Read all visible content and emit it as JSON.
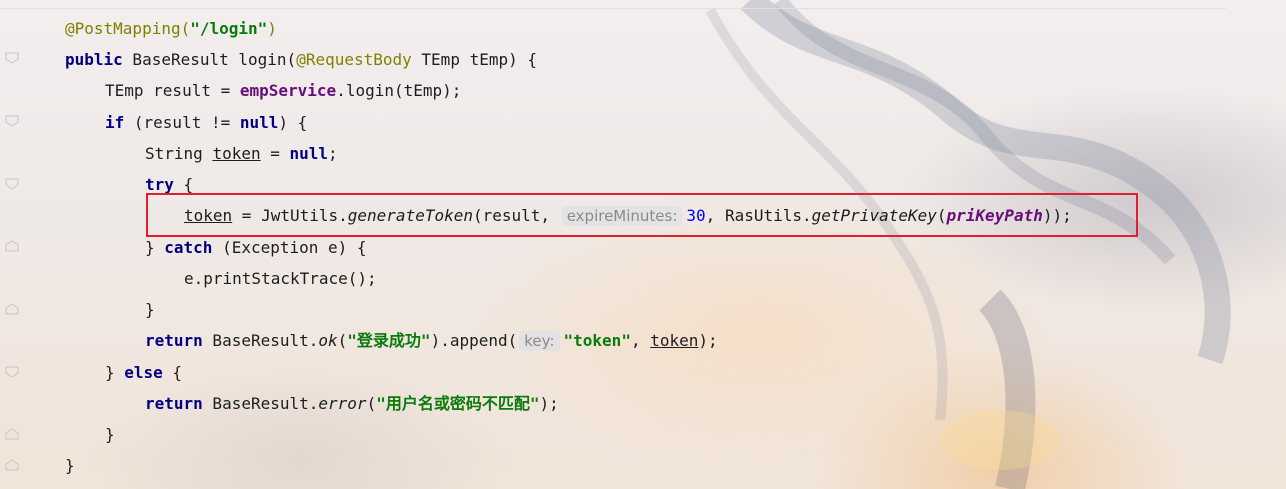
{
  "editor": {
    "lines": [
      {
        "id": "l1",
        "parts": [
          {
            "t": "@PostMapping(",
            "c": "anno"
          },
          {
            "t": "\"/login\"",
            "c": "str"
          },
          {
            "t": ")",
            "c": "anno"
          }
        ]
      },
      {
        "id": "l2",
        "parts": [
          {
            "t": "public",
            "c": "kw"
          },
          {
            "t": " BaseResult login(",
            "c": ""
          },
          {
            "t": "@RequestBody",
            "c": "anno"
          },
          {
            "t": " TEmp tEmp) {",
            "c": ""
          }
        ]
      },
      {
        "id": "l3",
        "parts": [
          {
            "t": "TEmp result = ",
            "c": ""
          },
          {
            "t": "empService",
            "c": "field"
          },
          {
            "t": ".login(tEmp);",
            "c": ""
          }
        ]
      },
      {
        "id": "l4",
        "parts": [
          {
            "t": "if",
            "c": "kw"
          },
          {
            "t": " (result != ",
            "c": ""
          },
          {
            "t": "null",
            "c": "kw"
          },
          {
            "t": ") {",
            "c": ""
          }
        ]
      },
      {
        "id": "l5",
        "parts": [
          {
            "t": "String ",
            "c": ""
          },
          {
            "t": "token",
            "c": "ul"
          },
          {
            "t": " = ",
            "c": ""
          },
          {
            "t": "null",
            "c": "kw"
          },
          {
            "t": ";",
            "c": ""
          }
        ]
      },
      {
        "id": "l6",
        "parts": [
          {
            "t": "try",
            "c": "kw"
          },
          {
            "t": " {",
            "c": ""
          }
        ]
      },
      {
        "id": "l7",
        "parts": [
          {
            "t": "token",
            "c": "ul"
          },
          {
            "t": " = JwtUtils.",
            "c": ""
          },
          {
            "t": "generateToken",
            "c": "ital"
          },
          {
            "t": "(result, ",
            "c": ""
          },
          {
            "t": "expireMinutes:",
            "c": "hint"
          },
          {
            "t": "30",
            "c": "num"
          },
          {
            "t": ", RasUtils.",
            "c": ""
          },
          {
            "t": "getPrivateKey",
            "c": "ital"
          },
          {
            "t": "(",
            "c": ""
          },
          {
            "t": "priKeyPath",
            "c": "static-field"
          },
          {
            "t": "));",
            "c": ""
          }
        ]
      },
      {
        "id": "l8",
        "parts": [
          {
            "t": "} ",
            "c": ""
          },
          {
            "t": "catch",
            "c": "kw"
          },
          {
            "t": " (Exception e) {",
            "c": ""
          }
        ]
      },
      {
        "id": "l9",
        "parts": [
          {
            "t": "e.printStackTrace();",
            "c": ""
          }
        ]
      },
      {
        "id": "l10",
        "parts": [
          {
            "t": "}",
            "c": ""
          }
        ]
      },
      {
        "id": "l11",
        "parts": [
          {
            "t": "return",
            "c": "kw"
          },
          {
            "t": " BaseResult.",
            "c": ""
          },
          {
            "t": "ok",
            "c": "ital"
          },
          {
            "t": "(",
            "c": ""
          },
          {
            "t": "\"登录成功\"",
            "c": "str"
          },
          {
            "t": ").append(",
            "c": ""
          },
          {
            "t": "key:",
            "c": "hint"
          },
          {
            "t": "\"token\"",
            "c": "str"
          },
          {
            "t": ", ",
            "c": ""
          },
          {
            "t": "token",
            "c": "ul"
          },
          {
            "t": ");",
            "c": ""
          }
        ]
      },
      {
        "id": "l12",
        "parts": [
          {
            "t": "} ",
            "c": ""
          },
          {
            "t": "else",
            "c": "kw"
          },
          {
            "t": " {",
            "c": ""
          }
        ]
      },
      {
        "id": "l13",
        "parts": [
          {
            "t": "return",
            "c": "kw"
          },
          {
            "t": " BaseResult.",
            "c": ""
          },
          {
            "t": "error",
            "c": "ital"
          },
          {
            "t": "(",
            "c": ""
          },
          {
            "t": "\"用户名或密码不匹配\"",
            "c": "str"
          },
          {
            "t": ");",
            "c": ""
          }
        ]
      },
      {
        "id": "l14",
        "parts": [
          {
            "t": "}",
            "c": ""
          }
        ]
      },
      {
        "id": "l15",
        "parts": [
          {
            "t": "}",
            "c": ""
          }
        ]
      }
    ]
  },
  "colors": {
    "keyword": "#000080",
    "annotation": "#808000",
    "string": "#0a7a0a",
    "field": "#660e7a",
    "number": "#0000ff",
    "highlight_box": "#e02030"
  },
  "icons": [
    "fold-marker-icon"
  ]
}
